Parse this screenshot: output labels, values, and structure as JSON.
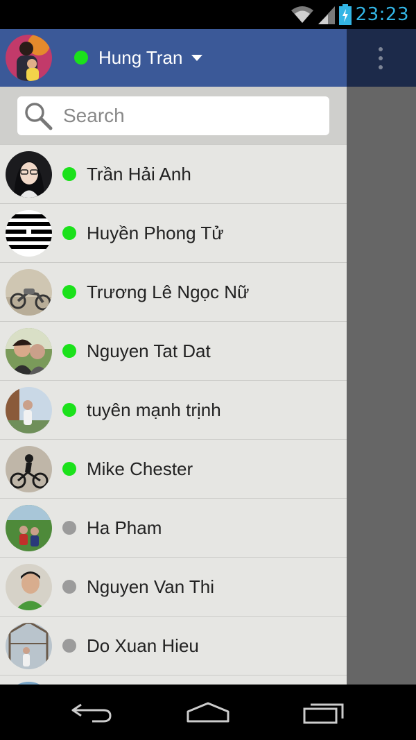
{
  "status_bar": {
    "time": "23:23",
    "icons": [
      "wifi-icon",
      "signal-icon",
      "battery-charging-icon"
    ],
    "time_color": "#33b5e5"
  },
  "header": {
    "user_name": "Hung Tran",
    "status": "online",
    "background_color": "#3b5998"
  },
  "search": {
    "placeholder": "Search"
  },
  "contacts": [
    {
      "name": "Trần Hải Anh",
      "status": "online"
    },
    {
      "name": "Huyền Phong Tử",
      "status": "online"
    },
    {
      "name": "Trương Lê Ngọc Nữ",
      "status": "online"
    },
    {
      "name": "Nguyen Tat Dat",
      "status": "online"
    },
    {
      "name": "tuyên mạnh trịnh",
      "status": "online"
    },
    {
      "name": "Mike Chester",
      "status": "online"
    },
    {
      "name": "Ha Pham",
      "status": "offline"
    },
    {
      "name": "Nguyen Van Thi",
      "status": "offline"
    },
    {
      "name": "Do Xuan Hieu",
      "status": "offline"
    }
  ],
  "colors": {
    "online": "#1be11b",
    "offline": "#9b9b9b"
  },
  "nav_bar": {
    "buttons": [
      "back-icon",
      "home-icon",
      "recent-apps-icon"
    ]
  }
}
